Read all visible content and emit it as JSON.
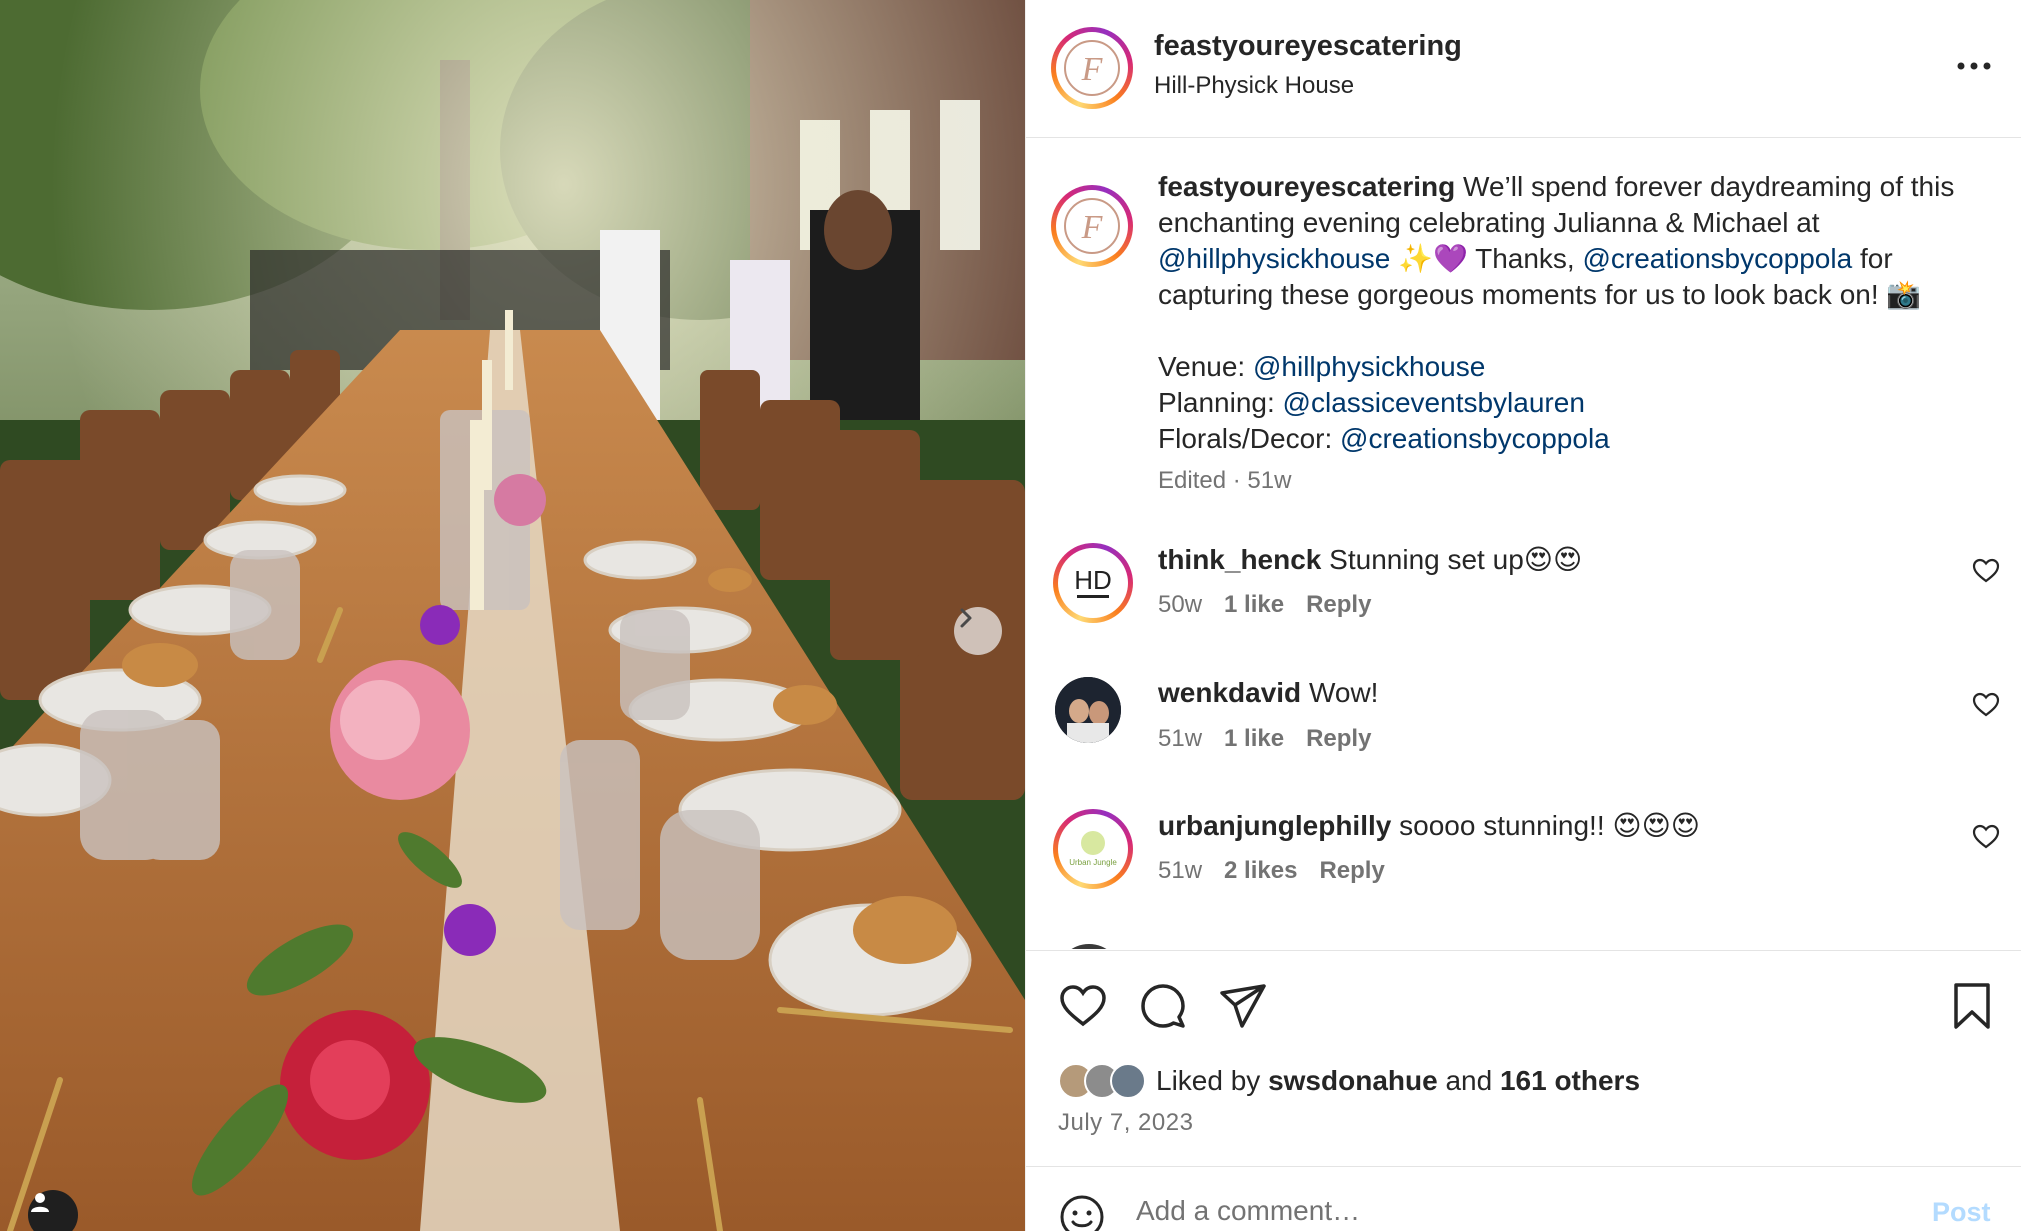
{
  "post": {
    "username": "feastyoureyescatering",
    "location": "Hill-Physick House",
    "more_icon": "more-horizontal-icon"
  },
  "caption": {
    "username": "feastyoureyescatering",
    "text_1": " We’ll spend forever daydreaming of this enchanting evening celebrating Julianna & Michael at ",
    "mention_1": "@hillphysickhouse",
    "text_2": " ✨💜 Thanks, ",
    "mention_2": "@creationsbycoppola",
    "text_3": " for capturing these gorgeous moments for us to look back on! 📸",
    "venue_label": "Venue: ",
    "venue_mention": "@hillphysickhouse",
    "planning_label": "Planning: ",
    "planning_mention": "@classiceventsbylauren",
    "florals_label": "Florals/Decor: ",
    "florals_mention": "@creationsbycoppola",
    "meta": "Edited · 51w"
  },
  "comments": [
    {
      "username": "think_henck",
      "text": " Stunning set up😍😍",
      "age": "50w",
      "likes": "1 like",
      "reply": "Reply",
      "avatar_text": "HD"
    },
    {
      "username": "wenkdavid",
      "text": " Wow!",
      "age": "51w",
      "likes": "1 like",
      "reply": "Reply"
    },
    {
      "username": "urbanjunglephilly",
      "text": " soooo stunning!! 😍😍😍",
      "age": "51w",
      "likes": "2 likes",
      "reply": "Reply",
      "avatar_text": "Urban Jungle"
    }
  ],
  "actions": {
    "like_icon": "heart-icon",
    "comment_icon": "comment-icon",
    "share_icon": "share-icon",
    "save_icon": "bookmark-icon",
    "liked_by_prefix": "Liked by ",
    "liked_by_user": "swsdonahue",
    "liked_by_middle": " and ",
    "liked_by_others": "161 others",
    "date": "July 7, 2023"
  },
  "add_comment": {
    "placeholder": "Add a comment…",
    "post_label": "Post",
    "emoji_icon": "smiley-icon"
  },
  "photo": {
    "next_icon": "chevron-right-icon",
    "tag_icon": "user-tag-icon"
  },
  "colors": {
    "link": "#00376b",
    "muted": "#737373",
    "post_disabled": "#b3dbff"
  }
}
